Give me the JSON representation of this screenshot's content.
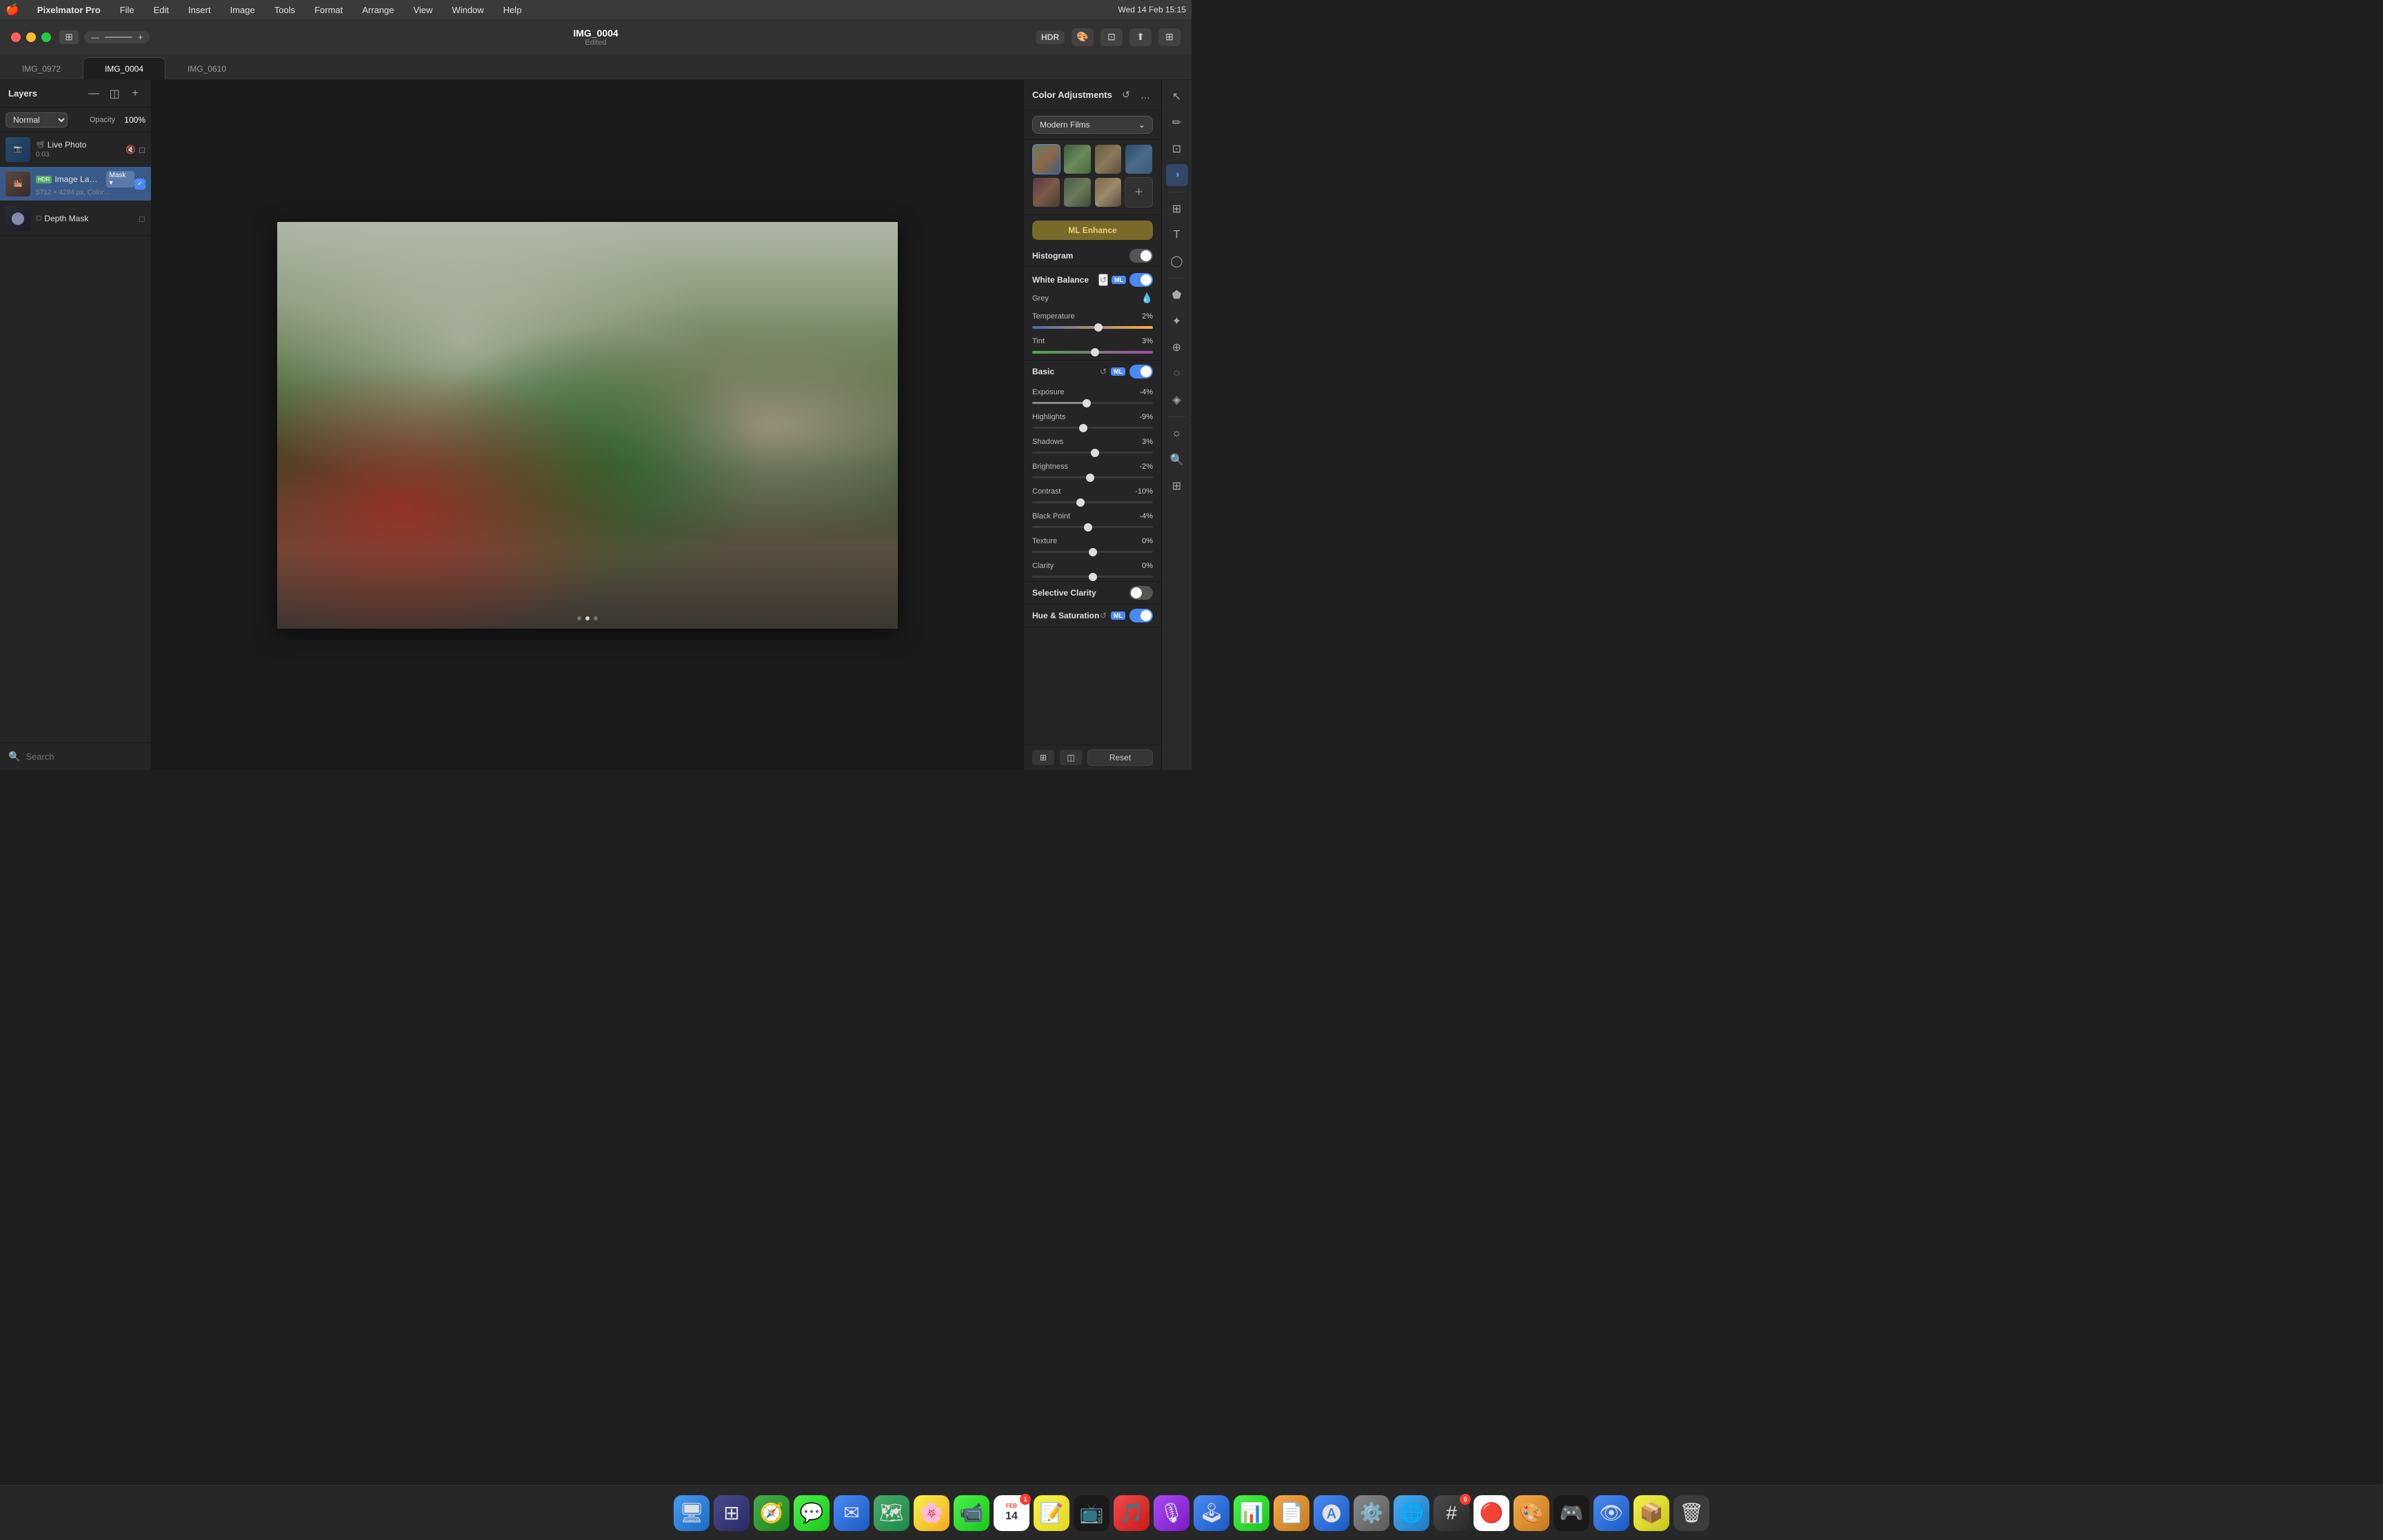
{
  "menubar": {
    "apple": "🍎",
    "app": "Pixelmator Pro",
    "menus": [
      "File",
      "Edit",
      "Insert",
      "Image",
      "Tools",
      "Format",
      "Arrange",
      "View",
      "Window",
      "Help"
    ],
    "time": "Wed 14 Feb  15:15"
  },
  "titlebar": {
    "filename": "IMG_0004",
    "subtitle": "Edited",
    "hdr_label": "HDR"
  },
  "tabs": [
    {
      "id": "tab-0972",
      "label": "IMG_0972"
    },
    {
      "id": "tab-0004",
      "label": "IMG_0004",
      "active": true
    },
    {
      "id": "tab-0610",
      "label": "IMG_0610"
    }
  ],
  "layers_panel": {
    "title": "Layers",
    "blend_mode": "Normal",
    "opacity_label": "Opacity",
    "opacity_value": "100%",
    "layers": [
      {
        "id": "live-photo",
        "name": "Live Photo",
        "meta": "0:03",
        "type": "LIVE",
        "has_visibility": true
      },
      {
        "id": "image-layer",
        "name": "Image Layer",
        "meta": "5712 × 4284 px, Color…",
        "type": "HDR",
        "has_mask": true,
        "is_selected": true,
        "is_checked": true
      },
      {
        "id": "depth-mask",
        "name": "Depth Mask",
        "meta": "",
        "type": "MASK"
      }
    ],
    "search_placeholder": "Search"
  },
  "color_adjustments": {
    "panel_title": "Color Adjustments",
    "preset_name": "Modern Films",
    "ml_enhance_label": "ML Enhance",
    "sections": {
      "histogram": {
        "label": "Histogram",
        "enabled": false
      },
      "white_balance": {
        "label": "White Balance",
        "enabled": true,
        "grey_label": "Grey",
        "temperature": {
          "label": "Temperature",
          "value": "2%",
          "position": 55
        },
        "tint": {
          "label": "Tint",
          "value": "3%",
          "position": 52
        }
      },
      "basic": {
        "label": "Basic",
        "enabled": true,
        "sliders": [
          {
            "label": "Exposure",
            "value": "-4%",
            "position": 45
          },
          {
            "label": "Highlights",
            "value": "-9%",
            "position": 42
          },
          {
            "label": "Shadows",
            "value": "3%",
            "position": 52
          },
          {
            "label": "Brightness",
            "value": "-2%",
            "position": 48
          },
          {
            "label": "Contrast",
            "value": "-10%",
            "position": 40
          },
          {
            "label": "Black Point",
            "value": "-4%",
            "position": 46
          },
          {
            "label": "Texture",
            "value": "0%",
            "position": 50
          },
          {
            "label": "Clarity",
            "value": "0%",
            "position": 50
          }
        ]
      },
      "selective_clarity": {
        "label": "Selective Clarity",
        "enabled": false
      },
      "hue_saturation": {
        "label": "Hue & Saturation",
        "enabled": true
      }
    },
    "reset_label": "Reset",
    "presets": [
      {
        "id": "p1",
        "class": "preset-1"
      },
      {
        "id": "p2",
        "class": "preset-2"
      },
      {
        "id": "p3",
        "class": "preset-3"
      },
      {
        "id": "p4",
        "class": "preset-4"
      },
      {
        "id": "p5",
        "class": "preset-5"
      },
      {
        "id": "p6",
        "class": "preset-6"
      },
      {
        "id": "p7",
        "class": "preset-7"
      },
      {
        "id": "p8",
        "class": "preset-8"
      }
    ]
  },
  "tools": [
    {
      "id": "cursor",
      "icon": "↖",
      "label": "Cursor tool"
    },
    {
      "id": "paint",
      "icon": "✏",
      "label": "Paint tool"
    },
    {
      "id": "erase",
      "icon": "◻",
      "label": "Erase tool"
    },
    {
      "id": "select",
      "icon": "⊡",
      "label": "Select tool"
    },
    {
      "id": "crop",
      "icon": "⊞",
      "label": "Crop tool"
    },
    {
      "id": "type",
      "icon": "T",
      "label": "Type tool"
    },
    {
      "id": "shape",
      "icon": "◯",
      "label": "Shape tool"
    },
    {
      "id": "color-adj",
      "icon": "◑",
      "label": "Color adjustments",
      "active": true
    },
    {
      "id": "gradient",
      "icon": "⬟",
      "label": "Gradient tool"
    },
    {
      "id": "heal",
      "icon": "✦",
      "label": "Healing tool"
    },
    {
      "id": "clone",
      "icon": "⊕",
      "label": "Clone tool"
    },
    {
      "id": "blur",
      "icon": "◌",
      "label": "Blur tool"
    },
    {
      "id": "sharpen",
      "icon": "◈",
      "label": "Sharpen tool"
    },
    {
      "id": "dodge",
      "icon": "☼",
      "label": "Dodge tool"
    },
    {
      "id": "zoom-tool",
      "icon": "⊕",
      "label": "Zoom tool"
    },
    {
      "id": "arrange",
      "icon": "⊞",
      "label": "Arrange tool"
    }
  ],
  "dock": {
    "items": [
      {
        "id": "finder",
        "icon": "🔵",
        "label": "Finder"
      },
      {
        "id": "launchpad",
        "icon": "🟢",
        "label": "Launchpad"
      },
      {
        "id": "safari",
        "icon": "🔵",
        "label": "Safari"
      },
      {
        "id": "messages",
        "icon": "🟢",
        "label": "Messages"
      },
      {
        "id": "mail",
        "icon": "🔵",
        "label": "Mail"
      },
      {
        "id": "maps",
        "icon": "🟢",
        "label": "Maps"
      },
      {
        "id": "photos",
        "icon": "🌸",
        "label": "Photos"
      },
      {
        "id": "facetime",
        "icon": "🟢",
        "label": "FaceTime"
      },
      {
        "id": "calendar",
        "icon": "🔴",
        "label": "Calendar",
        "badge": "14"
      },
      {
        "id": "notes",
        "icon": "🟡",
        "label": "Notes"
      },
      {
        "id": "appletv",
        "icon": "⚫",
        "label": "Apple TV"
      },
      {
        "id": "music",
        "icon": "🔴",
        "label": "Music"
      },
      {
        "id": "podcasts",
        "icon": "🟣",
        "label": "Podcasts"
      },
      {
        "id": "arcade",
        "icon": "🔵",
        "label": "Arcade"
      },
      {
        "id": "numbers",
        "icon": "🟢",
        "label": "Numbers"
      },
      {
        "id": "pages",
        "icon": "🟠",
        "label": "Pages"
      },
      {
        "id": "appstore",
        "icon": "🔵",
        "label": "App Store"
      },
      {
        "id": "systemprefs",
        "icon": "⚙️",
        "label": "System Preferences"
      },
      {
        "id": "edge",
        "icon": "🔵",
        "label": "Microsoft Edge"
      },
      {
        "id": "slack",
        "icon": "🟣",
        "label": "Slack",
        "badge": "5"
      },
      {
        "id": "chrome",
        "icon": "🔵",
        "label": "Google Chrome"
      },
      {
        "id": "pixelmator",
        "icon": "🟠",
        "label": "Pixelmator Pro"
      },
      {
        "id": "epicgames",
        "icon": "⚫",
        "label": "Epic Games"
      },
      {
        "id": "preview",
        "icon": "🔵",
        "label": "Preview"
      },
      {
        "id": "archiver",
        "icon": "🟡",
        "label": "Archiver"
      },
      {
        "id": "trash",
        "icon": "🗑",
        "label": "Trash"
      }
    ]
  }
}
